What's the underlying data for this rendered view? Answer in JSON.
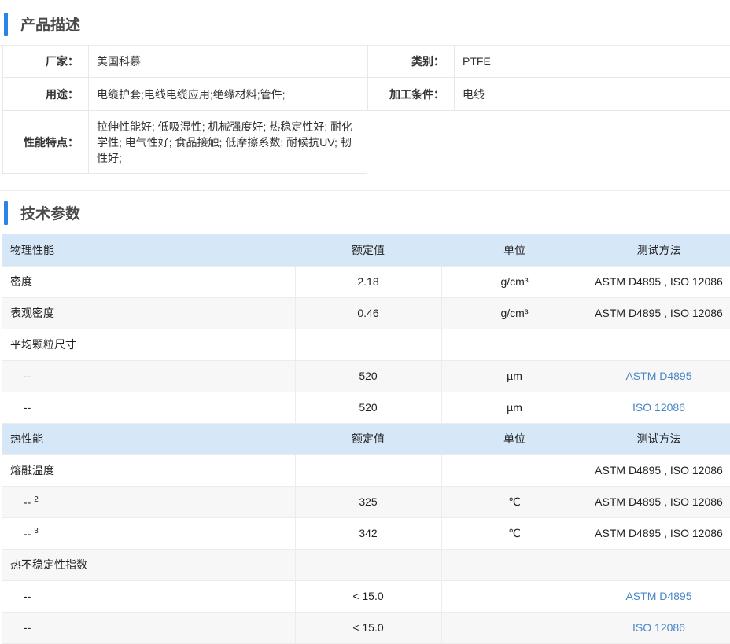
{
  "product_desc": {
    "title": "产品描述",
    "rows": [
      {
        "label": "厂家：",
        "value": "美国科慕",
        "label2": "类别：",
        "value2": "PTFE"
      },
      {
        "label": "用途：",
        "value": "电缆护套;电线电缆应用;绝缘材料;管件;",
        "label2": "加工条件：",
        "value2": "电线"
      },
      {
        "label": "性能特点：",
        "value": "拉伸性能好; 低吸湿性; 机械强度好; 热稳定性好; 耐化学性; 电气性好; 食品接触; 低摩擦系数; 耐候抗UV; 韧性好;"
      }
    ]
  },
  "tech_params": {
    "title": "技术参数",
    "physical_header": {
      "c0": "物理性能",
      "c1": "额定值",
      "c2": "单位",
      "c3": "测试方法"
    },
    "density": {
      "c0": "密度",
      "c1": "2.18",
      "c2": "g/cm³",
      "c3": "ASTM D4895 , ISO 12086"
    },
    "bulk_density": {
      "c0": "表观密度",
      "c1": "0.46",
      "c2": "g/cm³",
      "c3": "ASTM D4895 , ISO 12086"
    },
    "particle_size": {
      "c0": "平均颗粒尺寸"
    },
    "particle_size_1": {
      "c0": "--",
      "c1": "520",
      "c2": "µm",
      "c3": "ASTM D4895"
    },
    "particle_size_2": {
      "c0": "--",
      "c1": "520",
      "c2": "µm",
      "c3": "ISO 12086"
    },
    "thermal_header": {
      "c0": "热性能",
      "c1": "额定值",
      "c2": "单位",
      "c3": "测试方法"
    },
    "melt_temp": {
      "c0": "熔融温度",
      "c3": "ASTM D4895 , ISO 12086"
    },
    "melt_temp_1": {
      "c0": "--",
      "sup": "2",
      "c1": "325",
      "c2": "℃",
      "c3": "ASTM D4895 , ISO 12086"
    },
    "melt_temp_2": {
      "c0": "--",
      "sup": "3",
      "c1": "342",
      "c2": "℃",
      "c3": "ASTM D4895 , ISO 12086"
    },
    "thermal_instability": {
      "c0": "热不稳定性指数"
    },
    "thermal_instability_1": {
      "c0": "--",
      "c1": "< 15.0",
      "c3": "ASTM D4895"
    },
    "thermal_instability_2": {
      "c0": "--",
      "c1": "< 15.0",
      "c3": "ISO 12086"
    }
  },
  "colors": {
    "accent": "#2b83e6",
    "section_header_bg": "#d6e7f8",
    "link": "#4a86c5"
  }
}
